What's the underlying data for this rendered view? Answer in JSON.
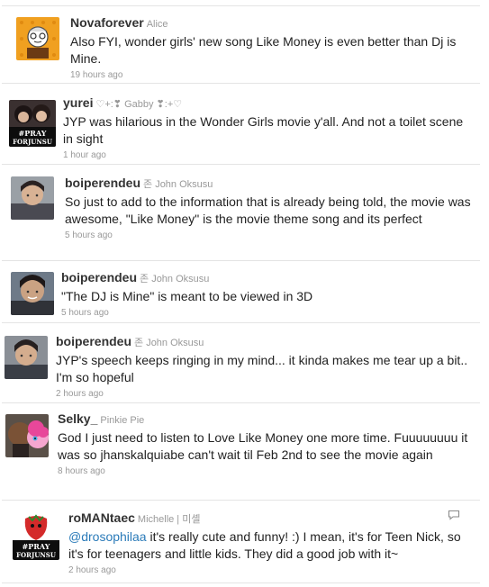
{
  "tweets": [
    {
      "screen_name": "Novaforever",
      "full_name": "Alice",
      "text": "Also FYI, wonder girls' new song Like Money is even better than Dj is Mine.",
      "time": "19 hours ago",
      "avatar": "mascot-avatar"
    },
    {
      "screen_name": "yurei",
      "full_name": "♡+:❣ Gabby ❣:+♡",
      "text": "JYP was hilarious in the Wonder Girls movie y'all. And not a toilet scene in sight",
      "time": "1 hour ago",
      "avatar": "pray-for-junsu-avatar",
      "avatar_text": [
        "#PRAY",
        "FORJUNSU"
      ]
    },
    {
      "screen_name": "boiperendeu",
      "full_name": "존 John Oksusu",
      "text": "So just to add to the information that is already being told, the movie was awesome, \"Like Money\" is the movie theme song and its perfect",
      "time": "5 hours ago",
      "avatar": "photo-avatar"
    },
    {
      "screen_name": "boiperendeu",
      "full_name": "존 John Oksusu",
      "text": "\"The DJ is Mine\" is meant to be viewed in 3D",
      "time": "5 hours ago",
      "avatar": "photo-avatar"
    },
    {
      "screen_name": "boiperendeu",
      "full_name": "존 John Oksusu",
      "text": "JYP's speech keeps ringing in my mind... it kinda makes me tear up a bit.. I'm so hopeful",
      "time": "2 hours ago",
      "avatar": "photo-avatar"
    },
    {
      "screen_name": "Selky_",
      "full_name": "Pinkie Pie",
      "text": "God I just need to listen to Love Like Money one more time. Fuuuuuuuu it was so jhanskalquiabe can't wait til Feb 2nd to see the movie again",
      "time": "8 hours ago",
      "avatar": "pinkie-pie-avatar"
    },
    {
      "screen_name": "roMANtaec",
      "full_name": "Michelle | 미셸",
      "mention": "@drosophilaa",
      "text": " it's really cute and funny! :) I mean, it's for Teen Nick, so it's for teenagers and little kids. They did a good job with it~",
      "time": "2 hours ago",
      "avatar": "strawberry-pray-avatar",
      "avatar_text": [
        "#PRAY",
        "FORJUNSU"
      ],
      "has_reply": true
    }
  ]
}
